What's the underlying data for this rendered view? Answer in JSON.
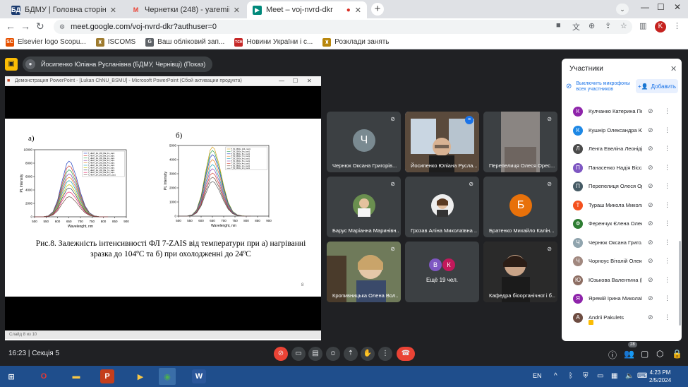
{
  "tabs": [
    {
      "title": "БДМУ | Головна сторінка",
      "icon": "БД",
      "color": "#1a3a6e"
    },
    {
      "title": "Чернетки (248) - yaremii.iryna@",
      "icon": "M",
      "color": "#ea4335"
    },
    {
      "title": "Meet – voj-nvrd-dkr",
      "icon": "▶",
      "color": "#00897b"
    }
  ],
  "url": "meet.google.com/voj-nvrd-dkr?authuser=0",
  "profile_initial": "K",
  "bookmarks": [
    {
      "label": "Elsevier logo Scopu...",
      "icon": "SC",
      "color": "#e65100"
    },
    {
      "label": "ISCOMS",
      "icon": "♜",
      "color": "#9e7b2f"
    },
    {
      "label": "Ваш обліковий зап...",
      "icon": "G",
      "color": "#5f6368"
    },
    {
      "label": "Новини України і с...",
      "icon": "ТСН",
      "color": "#c62828"
    },
    {
      "label": "Розклади занять",
      "icon": "♜",
      "color": "#b8860b"
    }
  ],
  "presenter": "Йосипенко Юліана Русланівна (БДМУ, Чернівці) (Показ)",
  "slide": {
    "window_title": "Демонстрация PowerPoint - [Lukan ChNU_BSMU] - Microsoft PowerPoint (Сбой активации продукта)",
    "label_a": "а)",
    "label_b": "б)",
    "caption": "Рис.8. Залежність інтенсивності ФЛ 7-ZAIS від температури при а) нагріванні зразка до 104ºС та б) при охолодженні до 24ºС",
    "page": "8",
    "status": "Слайд 8 из 10"
  },
  "chart_data": [
    {
      "type": "line",
      "title": "",
      "xlabel": "Wavelenght, nm",
      "ylabel": "PL Intensity",
      "xlim": [
        500,
        900
      ],
      "ylim": [
        0,
        10000
      ],
      "xticks": [
        500,
        550,
        600,
        650,
        700,
        750,
        800,
        850,
        900
      ],
      "yticks": [
        0,
        1000,
        2000,
        3000,
        4000,
        5000,
        6000,
        7000,
        8000,
        9000,
        10000
      ],
      "x": [
        500,
        520,
        540,
        560,
        580,
        600,
        620,
        640,
        650,
        660,
        680,
        700,
        720,
        740,
        760,
        780,
        800,
        820
      ],
      "series": [
        {
          "name": "T_HEAT_ZH_265_Bla_0m_cap1",
          "peak": 8300,
          "color": "#1f3fbf"
        },
        {
          "name": "T_HEAT_ZH_265_Bla_1m_cap1",
          "peak": 7600,
          "color": "#d03a2b"
        },
        {
          "name": "T_HEAT_ZH_265_Bla_2m_cap1",
          "peak": 7000,
          "color": "#2aa14c"
        },
        {
          "name": "T_HEAT_ZH_265_Bla_3m_cap1",
          "peak": 6400,
          "color": "#8e44ad"
        },
        {
          "name": "T_HEAT_ZH_265_Bla_4m_cap1",
          "peak": 5900,
          "color": "#e67e22"
        },
        {
          "name": "T_HEAT_ZH_265_Bla_5m_cap1",
          "peak": 5400,
          "color": "#17a2b8"
        },
        {
          "name": "T_HEAT_ZH_265_Bla_6m_cap1",
          "peak": 4800,
          "color": "#c0c000"
        },
        {
          "name": "T_HEAT_ZH_265_Bla_7m_cap1",
          "peak": 4300,
          "color": "#2c3e50"
        },
        {
          "name": "T_HEAT_ZH_265_Bla_8m_cap1",
          "peak": 3700,
          "color": "#e91e63"
        },
        {
          "name": "T_HEAT_ZH_265_Bla_10m_cap1",
          "peak": 3000,
          "color": "#6d4c41"
        }
      ]
    },
    {
      "type": "line",
      "title": "",
      "xlabel": "Wavelenght, nm",
      "ylabel": "PL Intensity",
      "xlim": [
        500,
        900
      ],
      "ylim": [
        0,
        5000
      ],
      "xticks": [
        500,
        550,
        600,
        650,
        700,
        750,
        800,
        850,
        900
      ],
      "yticks": [
        0,
        500,
        1000,
        1500,
        2000,
        2500,
        3000,
        3500,
        4000,
        4500,
        5000
      ],
      "x": [
        500,
        520,
        540,
        560,
        580,
        600,
        620,
        640,
        650,
        660,
        680,
        700,
        720,
        740,
        760,
        780,
        800,
        820
      ],
      "series": [
        {
          "name": "T_Bl_2500s_104_cool1",
          "peak": 4900,
          "color": "#d4a017"
        },
        {
          "name": "T_Bl_2500s_9m_cool1",
          "peak": 4650,
          "color": "#2aa14c"
        },
        {
          "name": "T_Bl_2500s_8m_cool1",
          "peak": 4350,
          "color": "#1f3fbf"
        },
        {
          "name": "T_Bl_2500s_7m_cool1",
          "peak": 4000,
          "color": "#e67e22"
        },
        {
          "name": "T_Bl_2500s_6m_cool1",
          "peak": 3650,
          "color": "#17a2b8"
        },
        {
          "name": "T_Bl_2500s_5m_cool1",
          "peak": 3350,
          "color": "#8e44ad"
        },
        {
          "name": "T_Bl_2500s_4m_cool1",
          "peak": 3050,
          "color": "#d03a2b"
        },
        {
          "name": "T_Bl_2500s_3m_cool1",
          "peak": 2750,
          "color": "#6d4c41"
        },
        {
          "name": "T_Bl_2500s_2m_cool1",
          "peak": 2450,
          "color": "#555555"
        }
      ]
    }
  ],
  "tiles": [
    {
      "name": "Чернюх Оксана Григорів...",
      "initial": "Ч",
      "color": "#7a8a91",
      "kind": "avatar"
    },
    {
      "name": "Йосипенко Юліана Русла...",
      "kind": "video",
      "speaking": true
    },
    {
      "name": "Перепелиця Олеся Орес...",
      "kind": "video2"
    },
    {
      "name": "Барус Маріанна Маринівн...",
      "kind": "photo"
    },
    {
      "name": "Грозав Аліна Миколаївна ...",
      "kind": "photo2"
    },
    {
      "name": "Братенко Михайло Калін...",
      "initial": "Б",
      "color": "#e8710a",
      "kind": "avatar"
    },
    {
      "name": "Кропивницька Олена Вол...",
      "kind": "video3"
    },
    {
      "name": "Ещё 19 чел.",
      "kind": "more",
      "more_initials": [
        "В",
        "К"
      ]
    },
    {
      "name": "Кафедра біоорганічної і б...",
      "kind": "video4"
    }
  ],
  "bottom": {
    "time": "16:23",
    "separator": "|",
    "section": "Секція 5",
    "participants_badge": "28"
  },
  "panel": {
    "title": "Участники",
    "mute_all": "Выключить микрофоны всех участников",
    "add": "Добавить",
    "participants": [
      {
        "name": "Кулчанко Катерина Пе...",
        "initial": "К",
        "color": "#8e24aa"
      },
      {
        "name": "Кушнір Олександра Ю...",
        "initial": "К",
        "color": "#1e88e5"
      },
      {
        "name": "Ленга Евеліна Леонідів...",
        "initial": "Л",
        "color": "#4a4a4a"
      },
      {
        "name": "Панасенко Надія Віссa...",
        "initial": "П",
        "color": "#7e57c2"
      },
      {
        "name": "Перепелиця Олеся Ор...",
        "initial": "П",
        "color": "#455a64"
      },
      {
        "name": "Тураш Микола Микола...",
        "initial": "Т",
        "color": "#f4511e"
      },
      {
        "name": "Ференчук Єлена Олек...",
        "initial": "Ф",
        "color": "#2e7d32"
      },
      {
        "name": "Чернюк Оксана Григо...",
        "initial": "Ч",
        "color": "#90a4ae"
      },
      {
        "name": "Чорноус Віталій Олекс...",
        "initial": "Ч",
        "color": "#a1887f"
      },
      {
        "name": "Юзькова Валентина (Б...",
        "initial": "Ю",
        "color": "#8d6e63"
      },
      {
        "name": "Яремій Ірина Миколаїв...",
        "initial": "Я",
        "color": "#8e24aa"
      },
      {
        "name": "Andrii Pakulets",
        "initial": "A",
        "color": "#6d4c41"
      }
    ]
  },
  "taskbar": {
    "lang": "EN",
    "time": "4:23 PM",
    "date": "2/5/2024"
  }
}
